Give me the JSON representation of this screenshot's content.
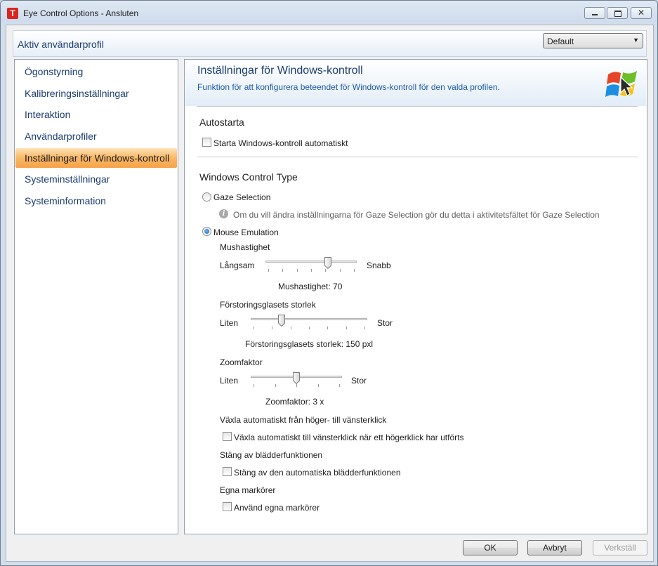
{
  "window": {
    "title": "Eye Control Options - Ansluten",
    "icon_letter": "T",
    "close_glyph": "✕"
  },
  "profile": {
    "label": "Aktiv användarprofil",
    "selected": "Default"
  },
  "nav": {
    "items": [
      {
        "label": "Ögonstyrning"
      },
      {
        "label": "Kalibreringsinställningar"
      },
      {
        "label": "Interaktion"
      },
      {
        "label": "Användarprofiler"
      },
      {
        "label": "Inställningar för Windows-kontroll",
        "active": true
      },
      {
        "label": "Systeminställningar"
      },
      {
        "label": "Systeminformation"
      }
    ]
  },
  "header": {
    "title": "Inställningar för Windows-kontroll",
    "description": "Funktion för att konfigurera beteendet för Windows-kontroll för den valda profilen."
  },
  "autostart": {
    "title": "Autostarta",
    "checkbox_label": "Starta Windows-kontroll automatiskt",
    "checked": false
  },
  "control_type": {
    "title": "Windows Control Type",
    "gaze_label": "Gaze Selection",
    "gaze_selected": false,
    "info_glyph": "i",
    "info_text": "Om du vill ändra inställningarna för Gaze Selection gör du detta i aktivitetsfältet för Gaze Selection",
    "mouse_label": "Mouse Emulation",
    "mouse_selected": true
  },
  "mouse_speed": {
    "title": "Mushastighet",
    "min_label": "Långsam",
    "max_label": "Snabb",
    "value_text": "Mushastighet: 70",
    "value_fraction": 0.7
  },
  "magnifier": {
    "title": "Förstoringsglasets storlek",
    "min_label": "Liten",
    "max_label": "Stor",
    "value_text": "Förstoringsglasets storlek: 150 pxl",
    "value_fraction": 0.25
  },
  "zoom": {
    "title": "Zoomfaktor",
    "min_label": "Liten",
    "max_label": "Stor",
    "value_text": "Zoomfaktor: 3 x",
    "value_fraction": 0.5
  },
  "right_click": {
    "title": "Växla automatiskt från höger- till vänsterklick",
    "checkbox_label": "Växla automatiskt till vänsterklick när ett högerklick har utförts",
    "checked": false
  },
  "scroll": {
    "title": "Stäng av bläddерfunktionen",
    "checkbox_label": "Stäng av den automatiska bläddерfunktionen",
    "checked": false
  },
  "cursors": {
    "title": "Egna markörer",
    "checkbox_label": "Använd egna markörer",
    "checked": false
  },
  "buttons": {
    "ok": "OK",
    "cancel": "Avbryt",
    "apply": "Verkställ"
  }
}
